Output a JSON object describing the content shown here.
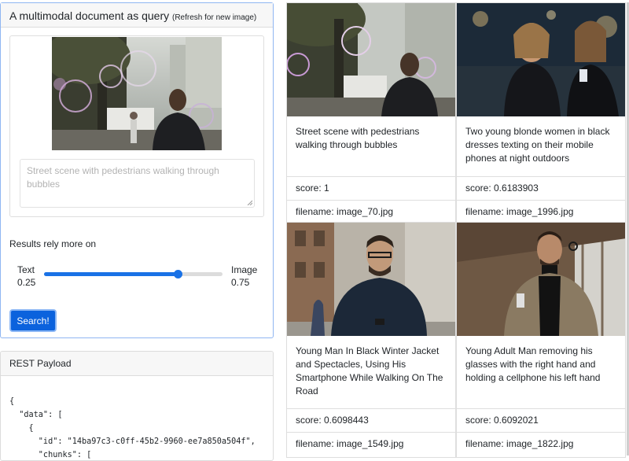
{
  "query_panel": {
    "title": "A multimodal document as query",
    "subtitle": "(Refresh for new image)",
    "text_value": "Street scene with pedestrians walking through bubbles",
    "rely_label": "Results rely more on",
    "slider": {
      "left_label": "Text",
      "left_value": "0.25",
      "right_label": "Image",
      "right_value": "0.75",
      "fraction_image": 0.75
    },
    "search_label": "Search!"
  },
  "payload": {
    "title": "REST Payload",
    "lines": [
      "{",
      "  \"data\": [",
      "    {",
      "      \"id\": \"14ba97c3-c0ff-45b2-9960-ee7a850a504f\",",
      "      \"chunks\": ["
    ]
  },
  "results": [
    {
      "caption": "Street scene with pedestrians walking through bubbles",
      "score": "score: 1",
      "filename": "filename: image_70.jpg"
    },
    {
      "caption": "Two young blonde women in black dresses texting on their mobile phones at night outdoors",
      "score": "score: 0.6183903",
      "filename": "filename: image_1996.jpg"
    },
    {
      "caption": "Young Man In Black Winter Jacket and Spectacles, Using His Smartphone While Walking On The Road",
      "score": "score: 0.6098443",
      "filename": "filename: image_1549.jpg"
    },
    {
      "caption": "Young Adult Man removing his glasses with the right hand and holding a cellphone his left hand",
      "score": "score: 0.6092021",
      "filename": "filename: image_1822.jpg"
    }
  ],
  "colors": {
    "accent": "#0b62dd",
    "slider": "#1a72e6",
    "card_border": "#dedede",
    "focus_border": "#8fb6f2"
  }
}
